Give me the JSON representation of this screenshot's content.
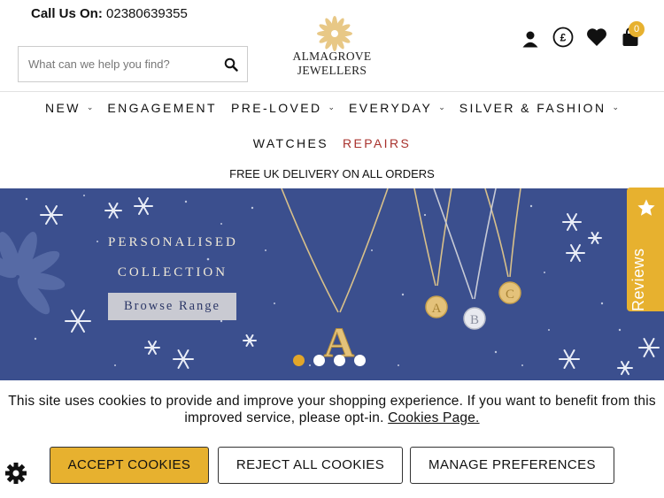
{
  "header": {
    "call_label": "Call Us On:",
    "phone": "02380639355",
    "search_placeholder": "What can we help you find?",
    "logo_text": "ALMAGROVE JEWELLERS",
    "basket_count": "0",
    "icons": [
      "account-icon",
      "currency-pound-icon",
      "wishlist-heart-icon",
      "basket-icon"
    ]
  },
  "nav": {
    "row1": [
      {
        "label": "NEW",
        "dropdown": true
      },
      {
        "label": "ENGAGEMENT",
        "dropdown": false
      },
      {
        "label": "PRE-LOVED",
        "dropdown": true
      },
      {
        "label": "EVERYDAY",
        "dropdown": true
      },
      {
        "label": "SILVER & FASHION",
        "dropdown": true
      }
    ],
    "row2": [
      {
        "label": "WATCHES"
      },
      {
        "label": "REPAIRS"
      }
    ]
  },
  "promo": "FREE UK DELIVERY ON ALL ORDERS",
  "banner": {
    "line1": "PERSONALISED",
    "line2": "COLLECTION",
    "button": "Browse Range",
    "slide_count": 4,
    "active_slide": 1
  },
  "reviews_tab": "Reviews",
  "cookies": {
    "message": "This site uses cookies to provide and improve your shopping experience. If you want to benefit from this improved service, please opt-in.",
    "link": "Cookies Page.",
    "accept": "ACCEPT COOKIES",
    "reject": "REJECT ALL COOKIES",
    "manage": "MANAGE PREFERENCES"
  },
  "colors": {
    "accent": "#e7b12f",
    "banner_bg": "#3b4f8e",
    "repairs": "#a8322d"
  }
}
